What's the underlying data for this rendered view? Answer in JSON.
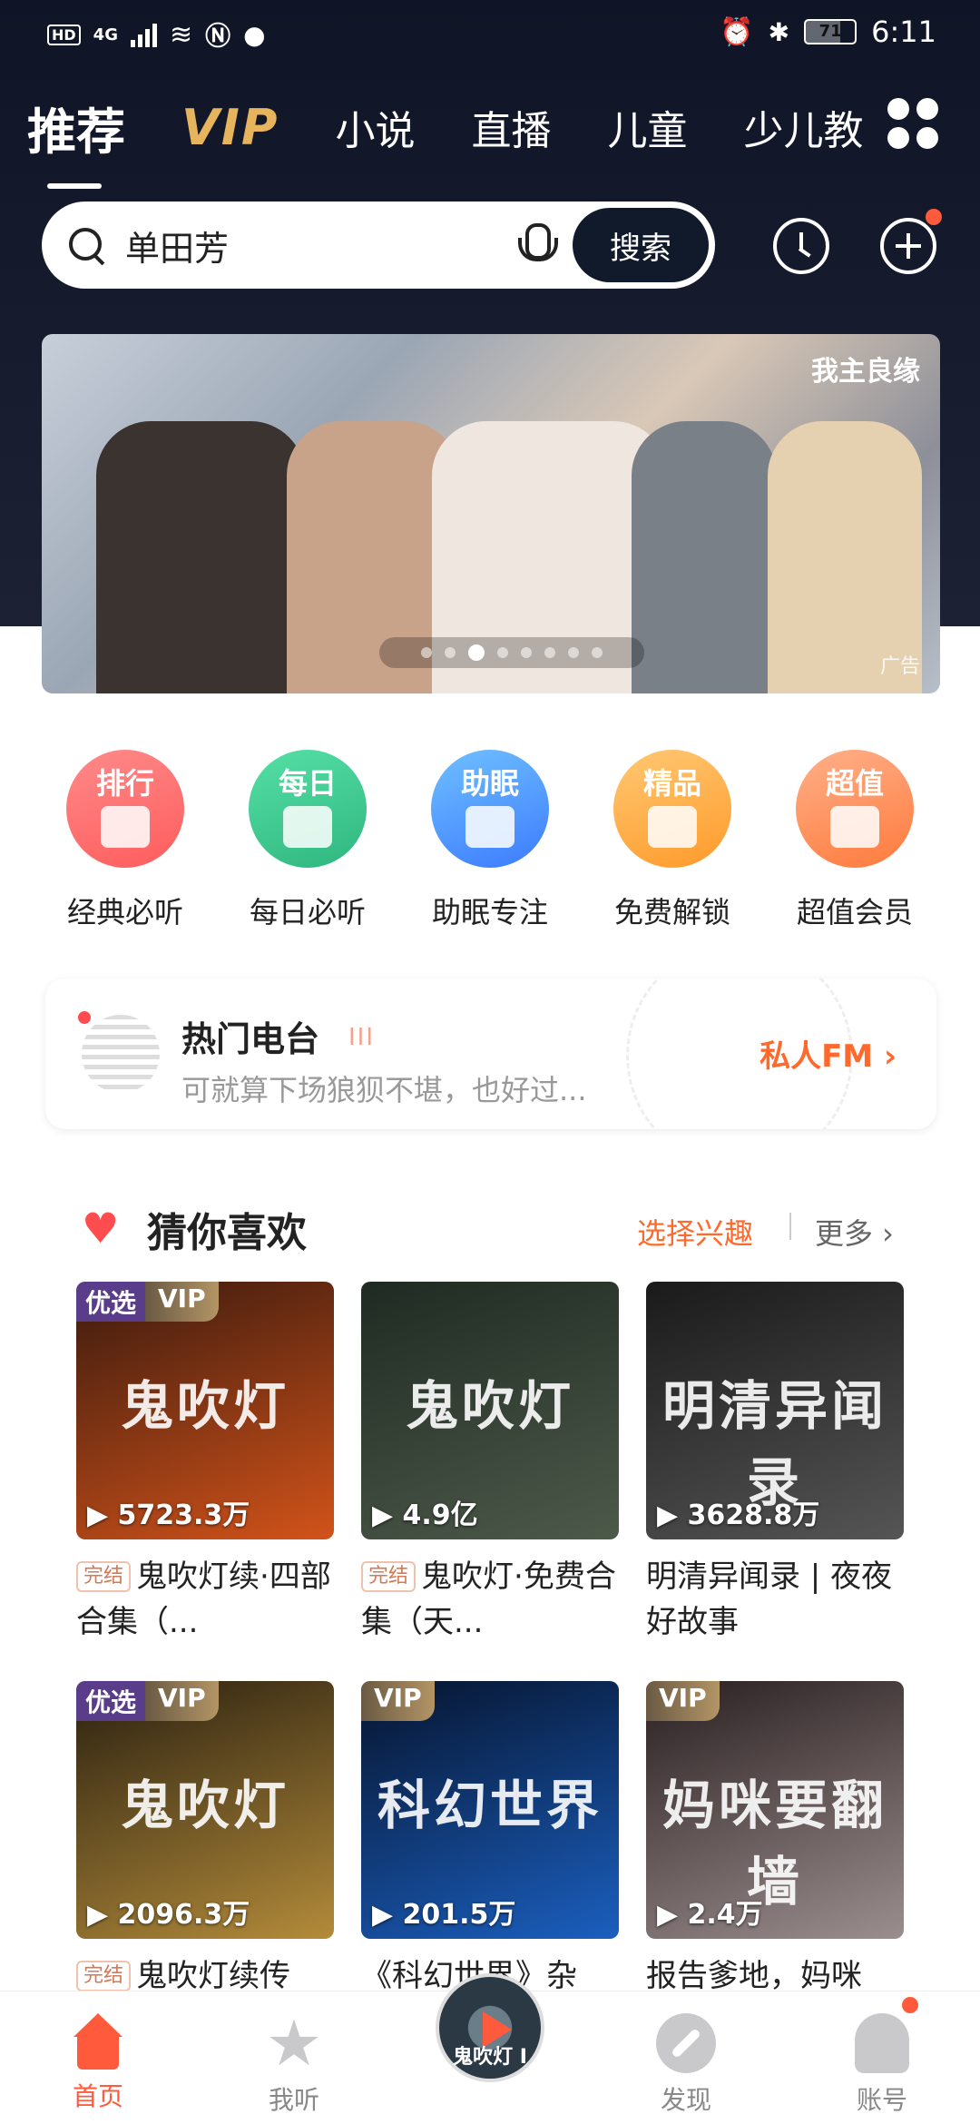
{
  "status_bar": {
    "left_chips": [
      "HD",
      "4G"
    ],
    "battery": "71",
    "time": "6:11"
  },
  "tabs": [
    {
      "label": "推荐",
      "active": true
    },
    {
      "label": "VIP",
      "vip": true
    },
    {
      "label": "小说"
    },
    {
      "label": "直播"
    },
    {
      "label": "儿童"
    },
    {
      "label": "少儿教"
    }
  ],
  "search": {
    "value": "单田芳",
    "button": "搜索"
  },
  "banner": {
    "logo_text": "我主良缘",
    "ad_label": "广告",
    "page_count": 8,
    "current_page": 3
  },
  "categories": [
    {
      "badge": "排行",
      "label": "经典必听",
      "color1": "#ff8a8a",
      "color2": "#ff5c5c"
    },
    {
      "badge": "每日",
      "label": "每日必听",
      "color1": "#55e0a6",
      "color2": "#2fb67f"
    },
    {
      "badge": "助眠",
      "label": "助眠专注",
      "color1": "#6fc0ff",
      "color2": "#3c7bff"
    },
    {
      "badge": "精品",
      "label": "免费解锁",
      "color1": "#ffc873",
      "color2": "#ff9a2a"
    },
    {
      "badge": "超值",
      "label": "超值会员",
      "color1": "#ffb08a",
      "color2": "#ff7a3c"
    }
  ],
  "radio": {
    "title": "热门电台",
    "subtitle": "可就算下场狼狈不堪，也好过...",
    "fm_label": "私人FM ›"
  },
  "guess": {
    "title": "猜你喜欢",
    "pick_interest": "选择兴趣",
    "more": "更多 ›",
    "items": [
      {
        "badges": [
          "优选",
          "VIP"
        ],
        "plays": "▶ 5723.3万",
        "tag": "完结",
        "title": "鬼吹灯续·四部合集（...",
        "cover_text": "鬼吹灯",
        "bg1": "#3b1a0e",
        "bg2": "#d2531a"
      },
      {
        "badges": [],
        "plays": "▶ 4.9亿",
        "tag": "完结",
        "title": "鬼吹灯·免费合集（天...",
        "cover_text": "鬼吹灯",
        "bg1": "#1f2a22",
        "bg2": "#4d5a4a"
      },
      {
        "badges": [],
        "plays": "▶ 3628.8万",
        "tag": "",
        "title": "明清异闻录 | 夜夜好故事",
        "cover_text": "明清异闻录",
        "bg1": "#1a1a1a",
        "bg2": "#555555"
      },
      {
        "badges": [
          "优选",
          "VIP"
        ],
        "plays": "▶ 2096.3万",
        "tag": "完结",
        "title": "鬼吹灯续传",
        "cover_text": "鬼吹灯",
        "bg1": "#2a2010",
        "bg2": "#b38b3a"
      },
      {
        "badges": [
          "VIP"
        ],
        "plays": "▶ 201.5万",
        "tag": "",
        "title": "《科幻世界》杂",
        "cover_text": "科幻世界",
        "bg1": "#06142e",
        "bg2": "#1b5fbf"
      },
      {
        "badges": [
          "VIP"
        ],
        "plays": "▶ 2.4万",
        "tag": "",
        "title": "报告爹地，妈咪",
        "cover_text": "妈咪要翻墙",
        "bg1": "#2a1f20",
        "bg2": "#9b8e8e"
      }
    ]
  },
  "bottom_nav": [
    {
      "label": "首页",
      "active": true,
      "icon": "home-icon"
    },
    {
      "label": "我听",
      "icon": "star-icon"
    },
    {
      "label": "",
      "icon": "player-icon",
      "player_text": "鬼吹灯 I"
    },
    {
      "label": "发现",
      "icon": "compass-icon"
    },
    {
      "label": "账号",
      "icon": "account-icon"
    }
  ]
}
